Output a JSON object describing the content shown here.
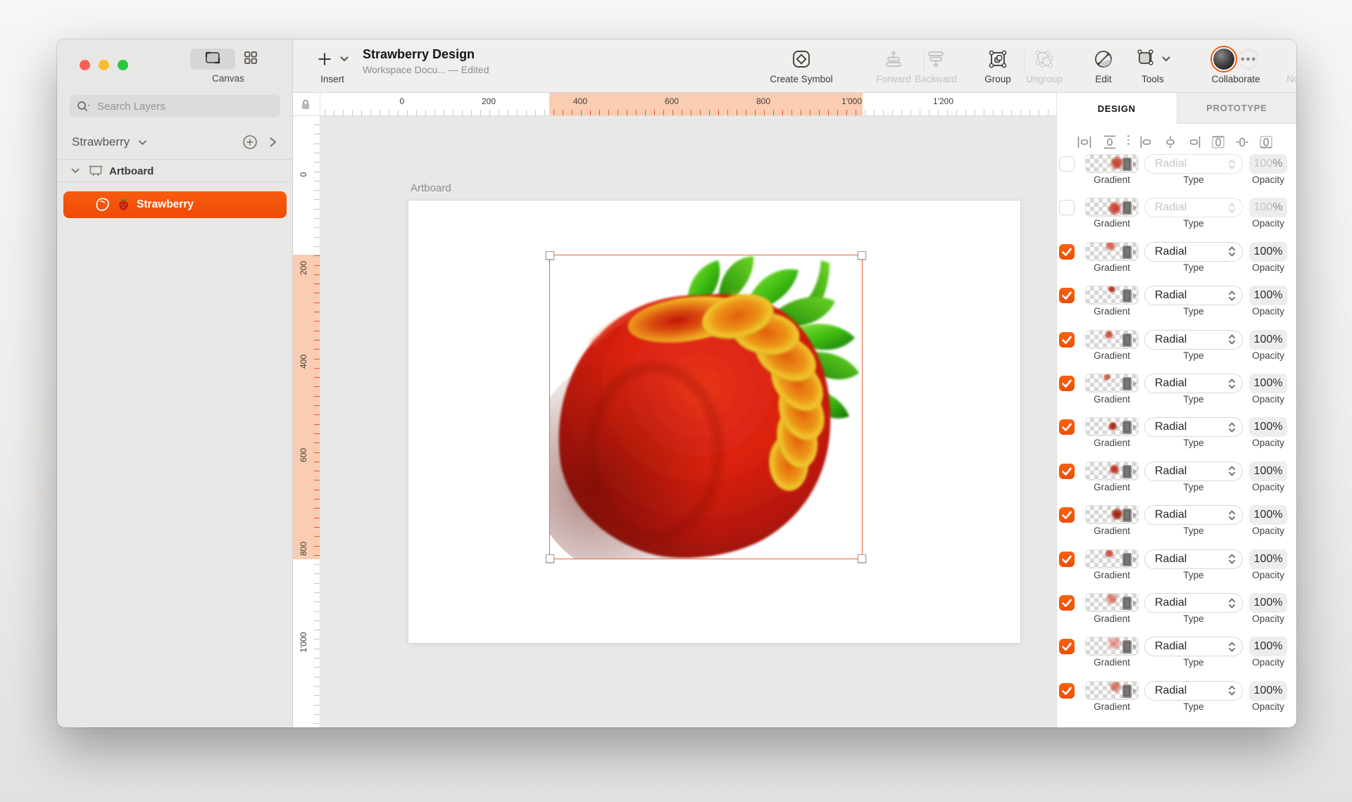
{
  "window_title_area": {
    "title": "Strawberry Design",
    "subtitle": "Workspace Docu... — Edited"
  },
  "sidebar": {
    "canvas_label": "Canvas",
    "search_placeholder": "Search Layers",
    "page_name": "Strawberry",
    "tree": [
      {
        "label": "Artboard",
        "type": "artboard"
      },
      {
        "label": "Strawberry",
        "type": "layer",
        "selected": true
      }
    ]
  },
  "toolbar": {
    "insert_label": "Insert",
    "buttons": [
      {
        "label": "Create Symbol",
        "enabled": true
      },
      {
        "label": "Forward",
        "enabled": false
      },
      {
        "label": "Backward",
        "enabled": false
      },
      {
        "label": "Group",
        "enabled": true
      },
      {
        "label": "Ungroup",
        "enabled": false
      },
      {
        "label": "Edit",
        "enabled": true
      },
      {
        "label": "Tools",
        "enabled": true
      },
      {
        "label": "Collaborate",
        "enabled": true
      },
      {
        "label": "Notifications",
        "enabled": false
      }
    ]
  },
  "rulers": {
    "h_labels": [
      "0",
      "200",
      "400",
      "600",
      "800",
      "1'000",
      "1'200"
    ],
    "v_labels": [
      "0",
      "200",
      "400",
      "600",
      "800",
      "1'000"
    ]
  },
  "canvas": {
    "artboard_title": "Artboard",
    "selected_layer": "Strawberry"
  },
  "inspector": {
    "tabs": [
      {
        "label": "DESIGN",
        "active": true
      },
      {
        "label": "PROTOTYPE",
        "active": false
      }
    ],
    "align_tools": [
      "distribute-horizontally",
      "distribute-vertically",
      "align-left",
      "align-center-horizontally",
      "align-right",
      "align-top",
      "align-middle",
      "align-bottom"
    ],
    "column_labels": {
      "gradient": "Gradient",
      "type": "Type",
      "opacity": "Opacity"
    },
    "rows": [
      {
        "enabled": false,
        "type": "Radial",
        "opacity": "100%",
        "blob": {
          "x": 60,
          "y": 46,
          "r": 9,
          "c": "#c22812",
          "a": 0.9
        }
      },
      {
        "enabled": false,
        "type": "Radial",
        "opacity": "100%",
        "blob": {
          "x": 56,
          "y": 55,
          "r": 9,
          "c": "#c22812",
          "a": 0.9
        }
      },
      {
        "enabled": true,
        "type": "Radial",
        "opacity": "100%",
        "blob": {
          "x": 47,
          "y": 18,
          "r": 7,
          "c": "#d4452e",
          "a": 0.85
        }
      },
      {
        "enabled": true,
        "type": "Radial",
        "opacity": "100%",
        "blob": {
          "x": 50,
          "y": 14,
          "r": 5,
          "c": "#b01e0c",
          "a": 0.95
        }
      },
      {
        "enabled": true,
        "type": "Radial",
        "opacity": "100%",
        "blob": {
          "x": 44,
          "y": 26,
          "r": 6,
          "c": "#c43018",
          "a": 0.85
        }
      },
      {
        "enabled": true,
        "type": "Radial",
        "opacity": "100%",
        "blob": {
          "x": 40,
          "y": 16,
          "r": 5,
          "c": "#c43018",
          "a": 0.8
        }
      },
      {
        "enabled": true,
        "type": "Radial",
        "opacity": "100%",
        "blob": {
          "x": 52,
          "y": 46,
          "r": 6,
          "c": "#a81c08",
          "a": 1
        }
      },
      {
        "enabled": true,
        "type": "Radial",
        "opacity": "100%",
        "blob": {
          "x": 55,
          "y": 42,
          "r": 7,
          "c": "#b42410",
          "a": 0.95
        }
      },
      {
        "enabled": true,
        "type": "Radial",
        "opacity": "100%",
        "blob": {
          "x": 60,
          "y": 46,
          "r": 8,
          "c": "#9e1a06",
          "a": 1
        }
      },
      {
        "enabled": true,
        "type": "Radial",
        "opacity": "100%",
        "blob": {
          "x": 45,
          "y": 22,
          "r": 6,
          "c": "#c03020",
          "a": 0.85
        }
      },
      {
        "enabled": true,
        "type": "Radial",
        "opacity": "100%",
        "blob": {
          "x": 50,
          "y": 26,
          "r": 8,
          "c": "#cc4734",
          "a": 0.7
        }
      },
      {
        "enabled": true,
        "type": "Radial",
        "opacity": "100%",
        "blob": {
          "x": 55,
          "y": 32,
          "r": 9,
          "c": "#d85a48",
          "a": 0.6
        }
      },
      {
        "enabled": true,
        "type": "Radial",
        "opacity": "100%",
        "blob": {
          "x": 57,
          "y": 30,
          "r": 8,
          "c": "#c84330",
          "a": 0.75
        }
      }
    ]
  },
  "colors": {
    "accent": "#f25708",
    "selection": "#e8643c",
    "ruler_highlight": "#facdb2",
    "traffic_close": "#ff5f57",
    "traffic_minimize": "#febc2e",
    "traffic_zoom": "#28c840"
  }
}
